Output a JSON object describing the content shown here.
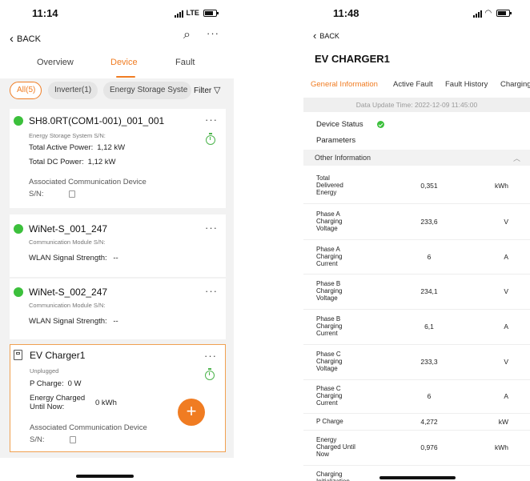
{
  "left": {
    "status": {
      "time": "11:14",
      "network": "LTE"
    },
    "back_label": "BACK",
    "tabs": [
      {
        "label": "Overview",
        "active": false
      },
      {
        "label": "Device",
        "active": true
      },
      {
        "label": "Fault",
        "active": false
      }
    ],
    "filters": [
      {
        "label": "All(5)",
        "active": true
      },
      {
        "label": "Inverter(1)",
        "active": false
      },
      {
        "label": "Energy Storage Syste",
        "active": false
      }
    ],
    "filter_label": "Filter",
    "devices": [
      {
        "name": "SH8.0RT(COM1-001)_001_001",
        "subtitle": "Energy Storage System S/N:",
        "lines": [
          {
            "label": "Total Active Power:",
            "value": "1,12  kW"
          },
          {
            "label": "Total DC Power:",
            "value": "1,12  kW"
          }
        ],
        "assoc_label": "Associated Communication Device",
        "sn_label": "S/N:"
      },
      {
        "name": "WiNet-S_001_247",
        "subtitle": "Communication Module S/N:",
        "lines": [
          {
            "label": "WLAN Signal Strength:",
            "value": " --"
          }
        ]
      },
      {
        "name": "WiNet-S_002_247",
        "subtitle": "Communication Module S/N:",
        "lines": [
          {
            "label": "WLAN Signal Strength:",
            "value": " --"
          }
        ]
      },
      {
        "name": "EV Charger1",
        "subtitle": "Unplugged",
        "lines": [
          {
            "label": "P Charge:",
            "value": "0  W"
          },
          {
            "label": "Energy Charged\nUntil Now:",
            "value": "0  kWh"
          }
        ],
        "assoc_label": "Associated Communication Device",
        "sn_label": "S/N:"
      }
    ],
    "fab_label": "+"
  },
  "right": {
    "status": {
      "time": "11:48"
    },
    "back_label": "BACK",
    "title": "EV CHARGER1",
    "tabs": [
      {
        "label": "General Information",
        "active": true
      },
      {
        "label": "Active Fault",
        "active": false
      },
      {
        "label": "Fault History",
        "active": false
      },
      {
        "label": "Charging",
        "active": false
      }
    ],
    "update_time": "Data Update Time: 2022-12-09 11:45:00",
    "device_status_label": "Device Status",
    "parameters_label": "Parameters",
    "other_info_label": "Other Information",
    "rows": [
      {
        "label": "Total\nDelivered\nEnergy",
        "value": "0,351",
        "unit": "kWh"
      },
      {
        "label": "Phase A\nCharging\nVoltage",
        "value": "233,6",
        "unit": "V"
      },
      {
        "label": "Phase A\nCharging\nCurrent",
        "value": "6",
        "unit": "A"
      },
      {
        "label": "Phase B\nCharging\nVoltage",
        "value": "234,1",
        "unit": "V"
      },
      {
        "label": "Phase B\nCharging\nCurrent",
        "value": "6,1",
        "unit": "A"
      },
      {
        "label": "Phase C\nCharging\nVoltage",
        "value": "233,3",
        "unit": "V"
      },
      {
        "label": "Phase C\nCharging\nCurrent",
        "value": "6",
        "unit": "A"
      },
      {
        "label": "P Charge",
        "value": "4,272",
        "unit": "kW"
      },
      {
        "label": "Energy\nCharged Until\nNow",
        "value": "0,976",
        "unit": "kWh"
      },
      {
        "label": "Charging\nInitialization",
        "value": "",
        "unit": ""
      }
    ]
  }
}
